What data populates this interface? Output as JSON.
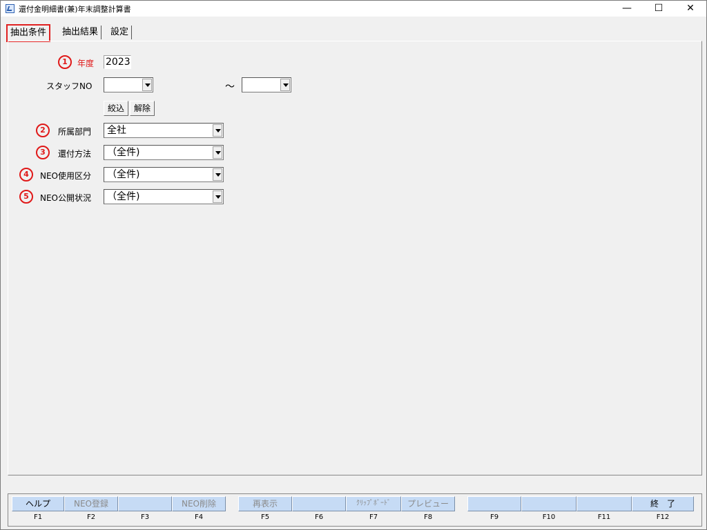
{
  "window": {
    "title": "還付金明細書(兼)年末調整計算書",
    "minimize": "—",
    "maximize": "☐",
    "close": "✕"
  },
  "tabs": [
    {
      "label": "抽出条件",
      "active": true
    },
    {
      "label": "抽出結果",
      "active": false
    },
    {
      "label": "設定",
      "active": false
    }
  ],
  "form": {
    "year": {
      "marker": "1",
      "label": "年度",
      "value": "2023"
    },
    "staff": {
      "label": "スタッフNO",
      "from": "",
      "tilde": "～",
      "to": ""
    },
    "filter_button": "絞込",
    "clear_button": "解除",
    "department": {
      "marker": "2",
      "label": "所属部門",
      "value": "全社"
    },
    "refund_method": {
      "marker": "3",
      "label": "還付方法",
      "value": "（全件)"
    },
    "neo_usage": {
      "marker": "4",
      "label": "NEO使用区分",
      "value": "（全件)"
    },
    "neo_publish": {
      "marker": "5",
      "label": "NEO公開状況",
      "value": "（全件)"
    }
  },
  "function_keys": [
    {
      "key": "F1",
      "label": "ヘルプ",
      "enabled": true
    },
    {
      "key": "F2",
      "label": "NEO登録",
      "enabled": false
    },
    {
      "key": "F3",
      "label": "",
      "enabled": false
    },
    {
      "key": "F4",
      "label": "NEO削除",
      "enabled": false
    },
    {
      "key": "F5",
      "label": "再表示",
      "enabled": false
    },
    {
      "key": "F6",
      "label": "",
      "enabled": false
    },
    {
      "key": "F7",
      "label": "ｸﾘｯﾌﾟﾎﾞｰﾄﾞ",
      "enabled": false
    },
    {
      "key": "F8",
      "label": "プレビュー",
      "enabled": false
    },
    {
      "key": "F9",
      "label": "",
      "enabled": false
    },
    {
      "key": "F10",
      "label": "",
      "enabled": false
    },
    {
      "key": "F11",
      "label": "",
      "enabled": false
    },
    {
      "key": "F12",
      "label": "終　了",
      "enabled": true
    }
  ],
  "colors": {
    "marker": "#e01818",
    "tab_highlight": "#e02020",
    "fkey_bg": "#c6dbf5"
  }
}
